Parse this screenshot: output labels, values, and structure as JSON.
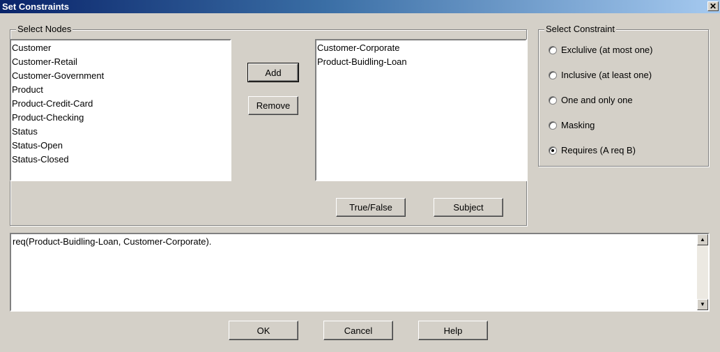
{
  "window": {
    "title": "Set Constraints",
    "close_glyph": "✕"
  },
  "select_nodes": {
    "label": "Select Nodes",
    "available": [
      "Customer",
      "Customer-Retail",
      "Customer-Government",
      "Product",
      "Product-Credit-Card",
      "Product-Checking",
      "Status",
      "Status-Open",
      "Status-Closed"
    ],
    "selected": [
      "Customer-Corporate",
      "Product-Buidling-Loan"
    ],
    "add_label": "Add",
    "remove_label": "Remove",
    "true_false_label": "True/False",
    "subject_label": "Subject"
  },
  "select_constraint": {
    "label": "Select Constraint",
    "options": [
      {
        "label": "Exclulive (at most one)",
        "checked": false
      },
      {
        "label": "Inclusive (at least one)",
        "checked": false
      },
      {
        "label": "One and only one",
        "checked": false
      },
      {
        "label": "Masking",
        "checked": false
      },
      {
        "label": "Requires (A req B)",
        "checked": true
      }
    ]
  },
  "output": {
    "text": "req(Product-Buidling-Loan, Customer-Corporate)."
  },
  "footer": {
    "ok_label": "OK",
    "cancel_label": "Cancel",
    "help_label": "Help"
  },
  "icons": {
    "scroll_up": "▲",
    "scroll_down": "▼"
  }
}
